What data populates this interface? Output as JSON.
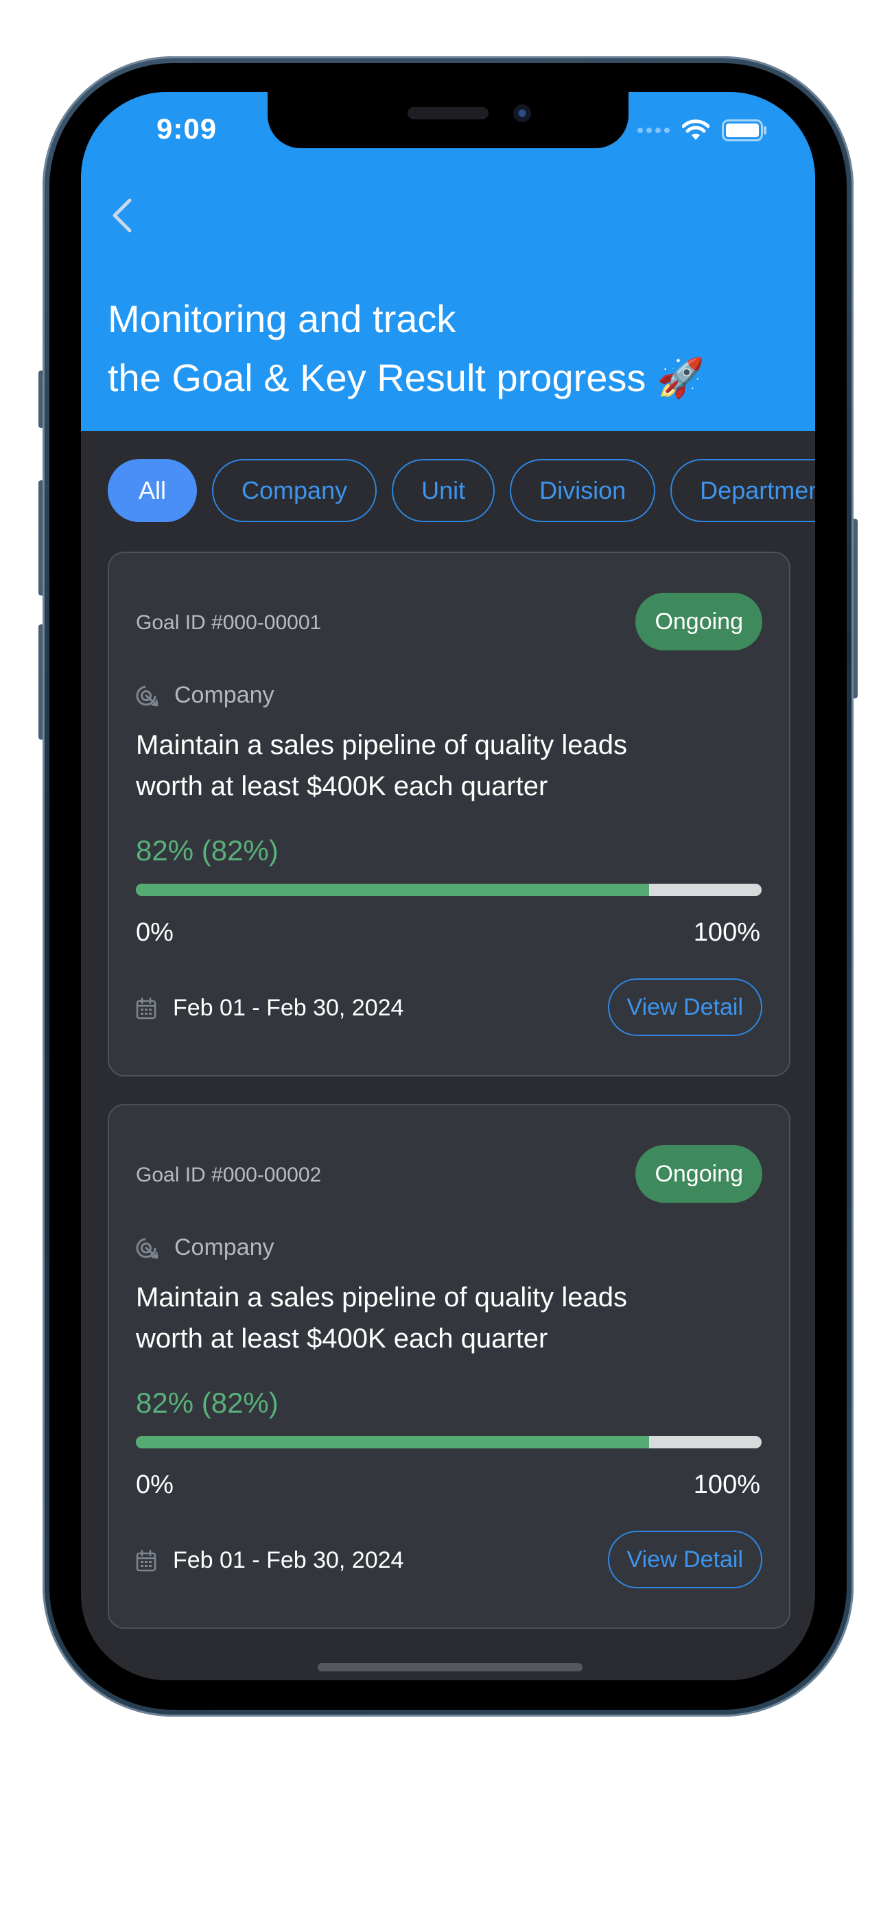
{
  "status_bar": {
    "time": "9:09"
  },
  "header": {
    "title_line1": "Monitoring and track",
    "title_line2": "the Goal & Key Result progress 🚀",
    "background_color": "#2196f3"
  },
  "filters": {
    "chips": [
      {
        "label": "All",
        "active": true
      },
      {
        "label": "Company",
        "active": false
      },
      {
        "label": "Unit",
        "active": false
      },
      {
        "label": "Division",
        "active": false
      },
      {
        "label": "Department",
        "active": false
      }
    ]
  },
  "goals": [
    {
      "goal_id": "Goal ID #000-00001",
      "status": "Ongoing",
      "scope": "Company",
      "title_line1": "Maintain a sales pipeline of quality leads",
      "title_line2": "worth at least $400K each quarter",
      "progress_label": "82% (82%)",
      "progress": 82,
      "range_min": "0%",
      "range_max": "100%",
      "date_range": "Feb 01 - Feb 30, 2024",
      "action_label": "View Detail"
    },
    {
      "goal_id": "Goal ID #000-00002",
      "status": "Ongoing",
      "scope": "Company",
      "title_line1": "Maintain a sales pipeline of quality leads",
      "title_line2": "worth at least $400K each quarter",
      "progress_label": "82% (82%)",
      "progress": 82,
      "range_min": "0%",
      "range_max": "100%",
      "date_range": "Feb 01 - Feb 30, 2024",
      "action_label": "View Detail"
    }
  ],
  "colors": {
    "accent": "#2f86e0",
    "status_ongoing": "#3f8a5c",
    "progress_fill": "#54ac73",
    "card_background": "#33363c",
    "screen_background": "#2a2c31"
  },
  "icons": {
    "back": "chevron-left-icon",
    "wifi": "wifi-icon",
    "battery": "battery-icon",
    "scope": "target-icon",
    "date": "calendar-icon"
  }
}
